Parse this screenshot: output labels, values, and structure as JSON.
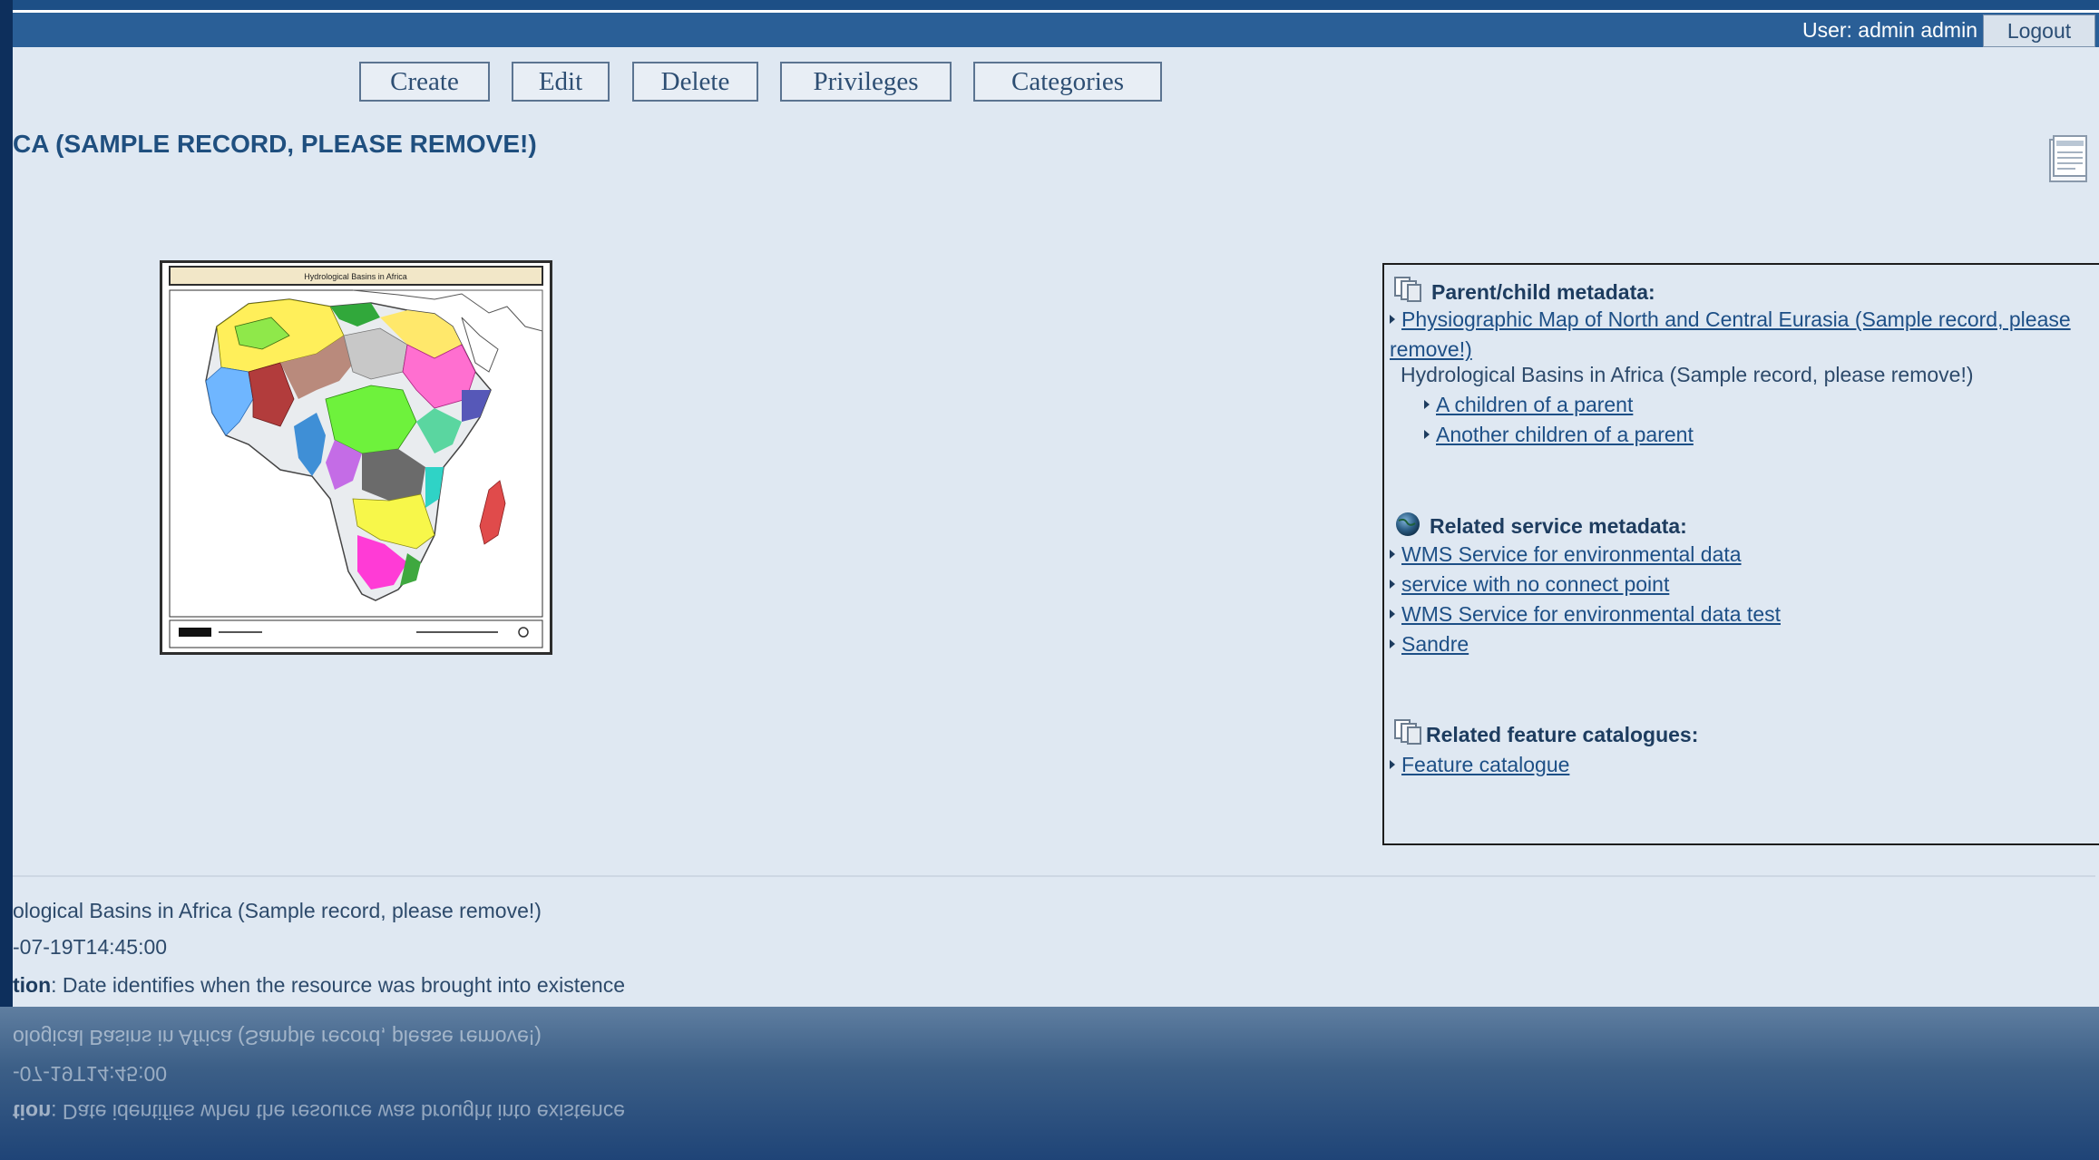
{
  "header": {
    "user_label": "User: admin admin",
    "logout_label": "Logout"
  },
  "toolbar": {
    "create": "Create",
    "edit": "Edit",
    "delete": "Delete",
    "privileges": "Privileges",
    "categories": "Categories"
  },
  "record": {
    "title": "CA (SAMPLE RECORD, PLEASE REMOVE!)",
    "thumbnail_title": "Hydrological Basins in Africa"
  },
  "sidebar": {
    "parent_child": {
      "heading": "Parent/child metadata:",
      "parent_link": "Physiographic Map of North and Central Eurasia (Sample record, please remove!)",
      "current": "Hydrological Basins in Africa (Sample record, please remove!)",
      "children": [
        "A children of a parent",
        "Another children of a parent"
      ]
    },
    "related_services": {
      "heading": "Related service metadata:",
      "items": [
        "WMS Service for environmental data",
        "service with no connect point",
        "WMS Service for environmental data test",
        "Sandre"
      ]
    },
    "feature_catalogues": {
      "heading": "Related feature catalogues:",
      "items": [
        "Feature catalogue"
      ]
    }
  },
  "details": {
    "title_value": "ological Basins in Africa (Sample record, please remove!)",
    "date_value": "-07-19T14:45:00",
    "date_type_label": "tion",
    "date_type_value": ": Date identifies when the resource was brought into existence"
  },
  "icons": {
    "doc": "document-icon",
    "parent_child": "stacked-pages-icon",
    "service": "globe-icon",
    "feature": "stacked-pages-icon"
  },
  "colors": {
    "topbar": "#2a5f97",
    "page_bg": "#dfe8f2",
    "title": "#1f4f7f",
    "link": "#1d4f86"
  }
}
